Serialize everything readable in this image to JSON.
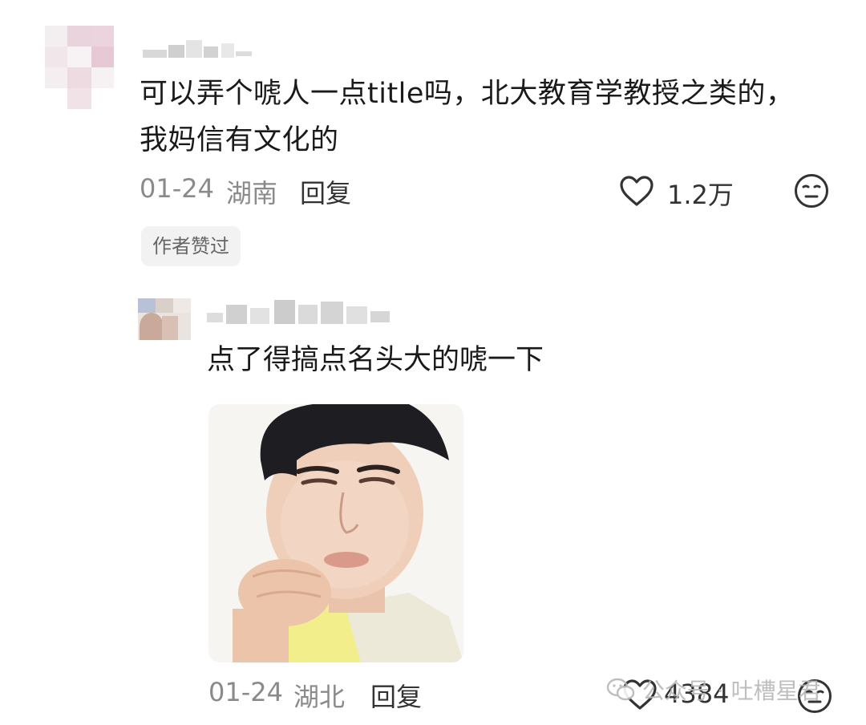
{
  "comment1": {
    "text_line1": "可以弄个唬人一点title吗，北大教育学教授之类的，",
    "text_line2": "我妈信有文化的",
    "date": "01-24",
    "location": "湖南",
    "reply_label": "回复",
    "likes": "1.2万",
    "badge": "作者赞过"
  },
  "comment2": {
    "text": "点了得搞点名头大的唬一下",
    "date": "01-24",
    "location": "湖北",
    "reply_label": "回复",
    "likes": "4384"
  },
  "watermark": {
    "text": "公众号 · 吐槽星君"
  },
  "icons": {
    "like": "heart-outline-icon",
    "emoji": "neutral-face-icon",
    "wechat": "wechat-icon"
  },
  "colors": {
    "text": "#1a1a1a",
    "meta": "#8a8a8a",
    "badge_bg": "#f2f2f2"
  }
}
